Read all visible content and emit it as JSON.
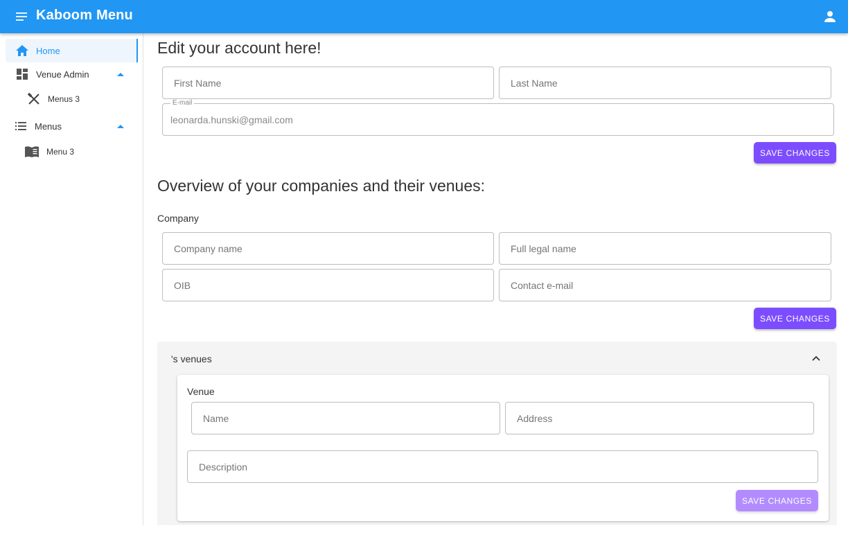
{
  "app": {
    "title": "Kaboom Menu",
    "accent_color": "#2196f3",
    "button_color": "#7c4dff"
  },
  "sidebar": {
    "items": [
      {
        "label": "Home",
        "icon": "home-icon",
        "active": true
      },
      {
        "label": "Venue Admin",
        "icon": "dashboard-icon",
        "expanded": true
      },
      {
        "label": "Menus 3",
        "icon": "fork-knife-icon"
      },
      {
        "label": "Menus",
        "icon": "list-icon",
        "expanded": true
      },
      {
        "label": "Menu 3",
        "icon": "menu-book-icon"
      }
    ]
  },
  "account": {
    "heading": "Edit your account here!",
    "first_name_placeholder": "First Name",
    "last_name_placeholder": "Last Name",
    "email_label": "E-mail",
    "email_value": "leonarda.hunski@gmail.com",
    "save_label": "SAVE CHANGES"
  },
  "companies": {
    "heading": "Overview of your companies and their venues:",
    "company_label": "Company",
    "company_name_placeholder": "Company name",
    "legal_name_placeholder": "Full legal name",
    "oib_placeholder": "OIB",
    "contact_email_placeholder": "Contact e-mail",
    "save_label": "SAVE CHANGES"
  },
  "venues": {
    "panel_title": "'s venues",
    "venue_label": "Venue",
    "name_placeholder": "Name",
    "address_placeholder": "Address",
    "description_placeholder": "Description",
    "save_label": "SAVE CHANGES"
  }
}
